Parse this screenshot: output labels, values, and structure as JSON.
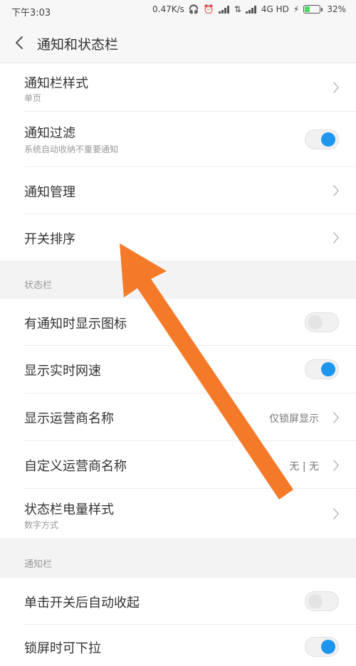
{
  "status_bar": {
    "time": "下午3:03",
    "speed": "0.47K/s",
    "network": "4G HD",
    "battery": "32%",
    "battery_level": 0.32
  },
  "header": {
    "title": "通知和状态栏",
    "back_icon": "back-chevron-icon"
  },
  "sections": [
    {
      "header": "",
      "items": [
        {
          "label": "通知栏样式",
          "sub": "单页",
          "control": "chevron"
        },
        {
          "label": "通知过滤",
          "sub": "系统自动收纳不重要通知",
          "control": "toggle",
          "on": true
        },
        {
          "label": "通知管理",
          "control": "chevron"
        },
        {
          "label": "开关排序",
          "control": "chevron"
        }
      ]
    },
    {
      "header": "状态栏",
      "items": [
        {
          "label": "有通知时显示图标",
          "control": "toggle",
          "on": false
        },
        {
          "label": "显示实时网速",
          "control": "toggle",
          "on": true
        },
        {
          "label": "显示运营商名称",
          "value": "仅锁屏显示",
          "control": "chevron"
        },
        {
          "label": "自定义运营商名称",
          "value": "无 | 无",
          "control": "chevron"
        },
        {
          "label": "状态栏电量样式",
          "sub": "数字方式",
          "control": "chevron"
        }
      ]
    },
    {
      "header": "通知栏",
      "items": [
        {
          "label": "单击开关后自动收起",
          "control": "toggle",
          "on": false
        },
        {
          "label": "锁屏时可下拉",
          "control": "toggle",
          "on": true
        }
      ]
    }
  ],
  "colors": {
    "accent": "#1e96f0",
    "annotation_arrow": "#f47a2a"
  }
}
